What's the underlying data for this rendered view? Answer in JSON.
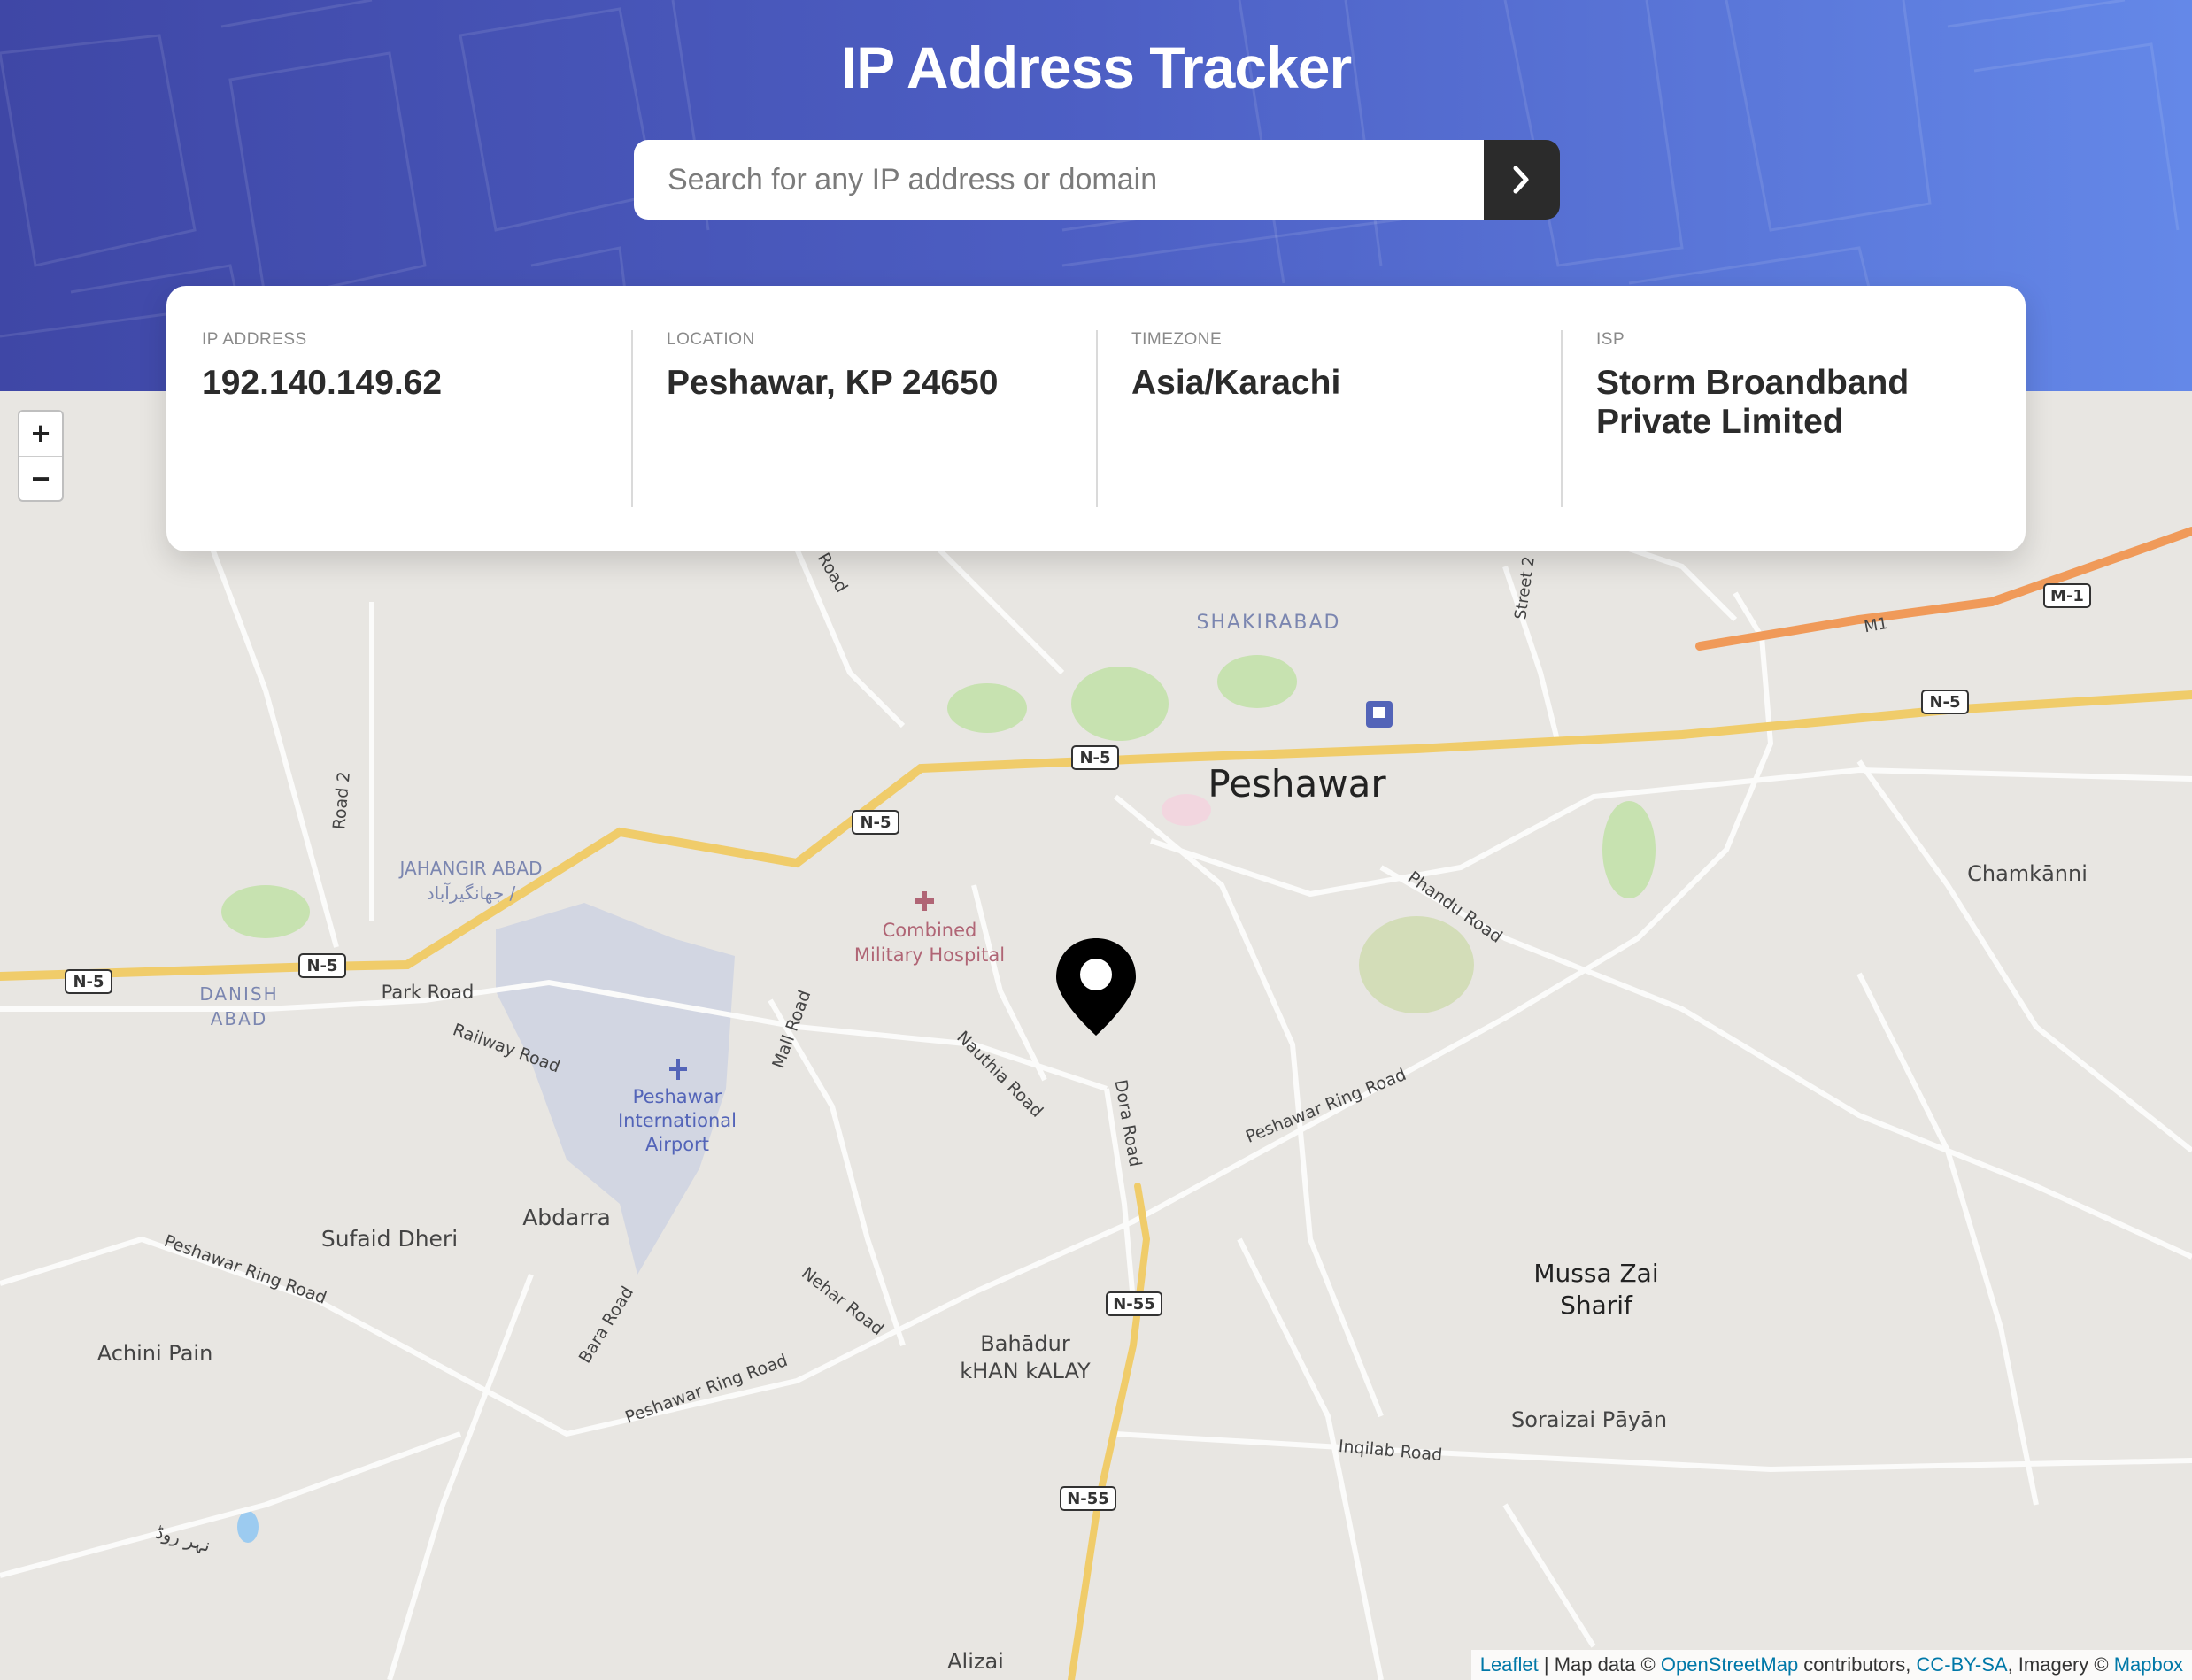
{
  "header": {
    "title": "IP Address Tracker",
    "search_placeholder": "Search for any IP address or domain",
    "search_value": ""
  },
  "info": [
    {
      "label": "IP ADDRESS",
      "value": "192.140.149.62"
    },
    {
      "label": "LOCATION",
      "value": "Peshawar, KP 24650"
    },
    {
      "label": "TIMEZONE",
      "value": "Asia/Karachi"
    },
    {
      "label": "ISP",
      "value": "Storm Broandband Private Limited"
    }
  ],
  "map": {
    "zoom_in": "+",
    "zoom_out": "−",
    "labels": {
      "peshawar": "Peshawar",
      "shakirabad": "SHAKIRABAD",
      "jahangir_abad": "JAHANGIR ABAD",
      "jahangir_abad_urdu": "جهانگیرآباد /",
      "danish_abad_1": "DANISH",
      "danish_abad_2": "ABAD",
      "park_road": "Park Road",
      "railway_road": "Railway Road",
      "hospital_1": "Combined",
      "hospital_2": "Military Hospital",
      "airport_1": "Peshawar",
      "airport_2": "International",
      "airport_3": "Airport",
      "mall_road": "Mall Road",
      "nauthia_road": "Nauthia Road",
      "dora_road": "Dora Road",
      "phandu_road": "Phandu Road",
      "ring_road_east": "Peshawar Ring Road",
      "ring_road_west": "Peshawar Ring Road",
      "ring_road_south": "Peshawar Ring Road",
      "chamkanni": "Chamkānni",
      "abdarra": "Abdarra",
      "sufaid_dheri": "Sufaid Dheri",
      "achini_pain": "Achini Pain",
      "bara_road": "Bara Road",
      "nehar_road": "Nehar Road",
      "bahadur_1": "Bahādur",
      "bahadur_2": "kHAN kALAY",
      "mussa_1": "Mussa Zai",
      "mussa_2": "Sharif",
      "soraizai": "Soraizai Pāyān",
      "inqilab_road": "Inqilab Road",
      "alizai": "Alizai",
      "road_2": "Road 2",
      "street_2": "Street 2",
      "road_top": "Road",
      "nehr_urdu": "نہر روڈ",
      "m1": "M1"
    },
    "shields": {
      "n5_a": "N-5",
      "n5_b": "N-5",
      "n5_c": "N-5",
      "n5_d": "N-5",
      "n5_e": "N-5",
      "m1_shield": "M-1",
      "n55_a": "N-55",
      "n55_b": "N-55"
    },
    "attribution": {
      "leaflet": "Leaflet",
      "sep1": " | Map data © ",
      "osm": "OpenStreetMap",
      "sep2": " contributors, ",
      "license": "CC-BY-SA",
      "sep3": ", Imagery © ",
      "mapbox": "Mapbox"
    }
  }
}
